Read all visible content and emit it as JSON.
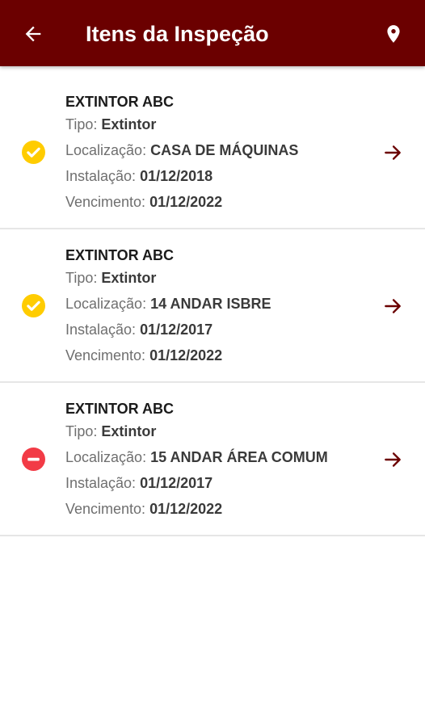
{
  "colors": {
    "appbar": "#6b0000",
    "ok": "#ffcc00",
    "error": "#f23b46",
    "arrow": "#6b0000"
  },
  "header": {
    "title": "Itens da Inspeção",
    "back_icon": "arrow-left-icon",
    "location_icon": "map-pin-icon"
  },
  "labels": {
    "tipo": "Tipo:",
    "localizacao": "Localização:",
    "instalacao": "Instalação:",
    "vencimento": "Vencimento:"
  },
  "items": [
    {
      "name": "EXTINTOR ABC",
      "tipo": "Extintor",
      "localizacao": "CASA DE MÁQUINAS",
      "instalacao": "01/12/2018",
      "vencimento": "01/12/2022",
      "status": "ok",
      "status_icon": "check-circle-icon"
    },
    {
      "name": "EXTINTOR ABC",
      "tipo": "Extintor",
      "localizacao": "14 ANDAR ISBRE",
      "instalacao": "01/12/2017",
      "vencimento": "01/12/2022",
      "status": "ok",
      "status_icon": "check-circle-icon"
    },
    {
      "name": "EXTINTOR ABC",
      "tipo": "Extintor",
      "localizacao": "15 ANDAR ÁREA COMUM",
      "instalacao": "01/12/2017",
      "vencimento": "01/12/2022",
      "status": "error",
      "status_icon": "minus-circle-icon"
    }
  ]
}
